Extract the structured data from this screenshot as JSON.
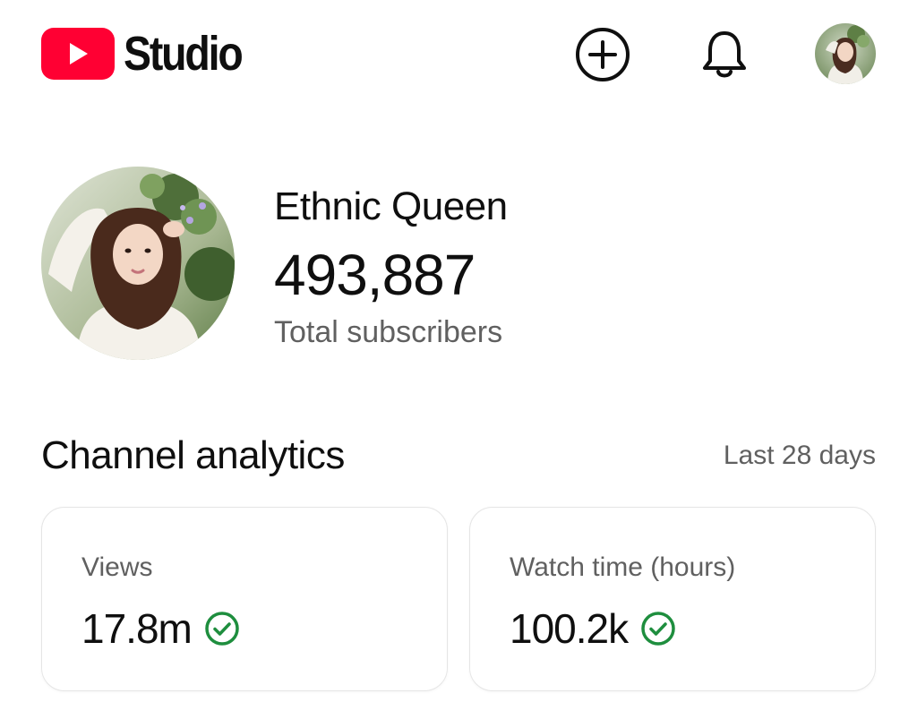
{
  "header": {
    "brand": "Studio",
    "icons": {
      "logo": "youtube-play-icon",
      "create": "add-circle-icon",
      "notifications": "bell-icon",
      "account": "avatar"
    }
  },
  "channel": {
    "name": "Ethnic Queen",
    "subscriber_count": "493,887",
    "subscriber_label": "Total subscribers"
  },
  "analytics": {
    "title": "Channel analytics",
    "period": "Last 28 days",
    "cards": [
      {
        "label": "Views",
        "value": "17.8m",
        "status_icon": "check-circle-icon"
      },
      {
        "label": "Watch time (hours)",
        "value": "100.2k",
        "status_icon": "check-circle-icon"
      }
    ]
  },
  "colors": {
    "brand_red": "#ff0033",
    "text_primary": "#0f0f0f",
    "text_secondary": "#606060",
    "success_green": "#1e8e3e",
    "card_border": "#e5e5e5"
  }
}
